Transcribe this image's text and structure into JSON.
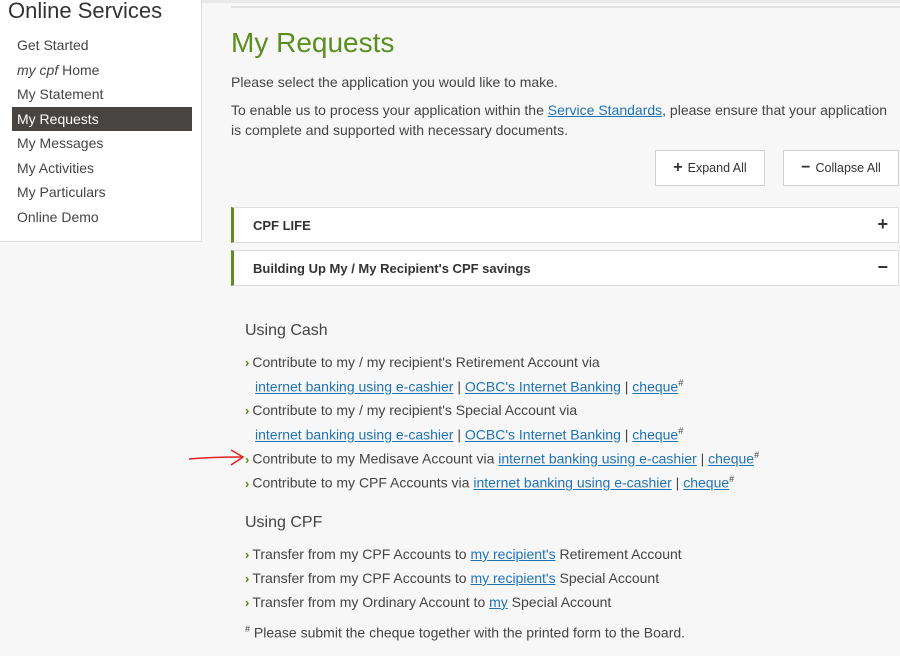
{
  "sidebar": {
    "title": "Online Services",
    "items": [
      {
        "label": "Get Started"
      },
      {
        "label_em": "my cpf",
        "label": " Home"
      },
      {
        "label": "My Statement"
      },
      {
        "label": "My Requests",
        "active": true
      },
      {
        "label": "My Messages"
      },
      {
        "label": "My Activities"
      },
      {
        "label": "My Particulars"
      },
      {
        "label": "Online Demo"
      }
    ]
  },
  "main": {
    "title": "My Requests",
    "intro": "Please select the application you would like to make.",
    "intro2_before": "To enable us to process your application within the ",
    "intro2_link": "Service Standards",
    "intro2_after": ", please ensure that your application is complete and supported with necessary documents.",
    "expand_all": "Expand All",
    "collapse_all": "Collapse All",
    "accordions": [
      {
        "title": "CPF LIFE",
        "toggle": "+",
        "expanded": false
      },
      {
        "title": "Building Up My / My Recipient's CPF savings",
        "toggle": "−",
        "expanded": true
      }
    ],
    "using_cash": {
      "heading": "Using Cash",
      "items": [
        {
          "text": "Contribute to my / my recipient's Retirement Account via",
          "links": [
            "internet banking using e-cashier",
            "OCBC's Internet Banking",
            "cheque"
          ]
        },
        {
          "text": "Contribute to my / my recipient's Special Account via",
          "links": [
            "internet banking using e-cashier",
            "OCBC's Internet Banking",
            "cheque"
          ]
        },
        {
          "text": "Contribute to my Medisave Account via ",
          "links": [
            "internet banking using e-cashier",
            "cheque"
          ]
        },
        {
          "text": "Contribute to my CPF Accounts via ",
          "links": [
            "internet banking using e-cashier",
            "cheque"
          ]
        }
      ]
    },
    "using_cpf": {
      "heading": "Using CPF",
      "items": [
        {
          "before": "Transfer from my CPF Accounts to ",
          "link": "my recipient's",
          "after": " Retirement Account"
        },
        {
          "before": "Transfer from my CPF Accounts to ",
          "link": "my recipient's",
          "after": " Special Account"
        },
        {
          "before": "Transfer from my Ordinary Account to ",
          "link": "my",
          "after": " Special Account"
        }
      ]
    },
    "separator": " | ",
    "footnote_mark": "#",
    "footnote": " Please submit the cheque together with the printed form to the Board.",
    "annotation_color": "#e02020"
  }
}
